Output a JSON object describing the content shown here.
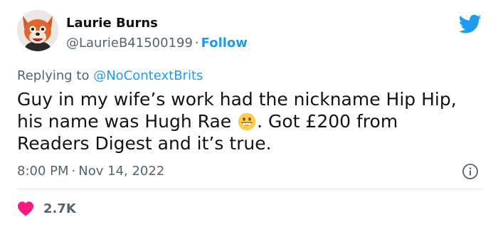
{
  "author": {
    "display_name": "Laurie Burns",
    "handle": "@LaurieB41500199",
    "separator": "·",
    "follow_label": "Follow"
  },
  "reply": {
    "prefix": "Replying to ",
    "mention": "@NoContextBrits"
  },
  "tweet": {
    "text_part1": "Guy in my wife’s work had the nickname Hip Hip,\nhis name was Hugh Rae ",
    "text_part2": ". Got £200 from\nReaders Digest and it’s true.",
    "emoji": "grinning-face"
  },
  "meta": {
    "time": "8:00 PM",
    "separator": "·",
    "date": "Nov 14, 2022"
  },
  "stats": {
    "likes": "2.7K"
  },
  "colors": {
    "accent": "#1d9bf0",
    "text": "#0f1419",
    "muted": "#536471",
    "like": "#f91880"
  },
  "icons": {
    "brand": "twitter-bird-icon",
    "info": "info-icon",
    "like": "heart-icon"
  }
}
